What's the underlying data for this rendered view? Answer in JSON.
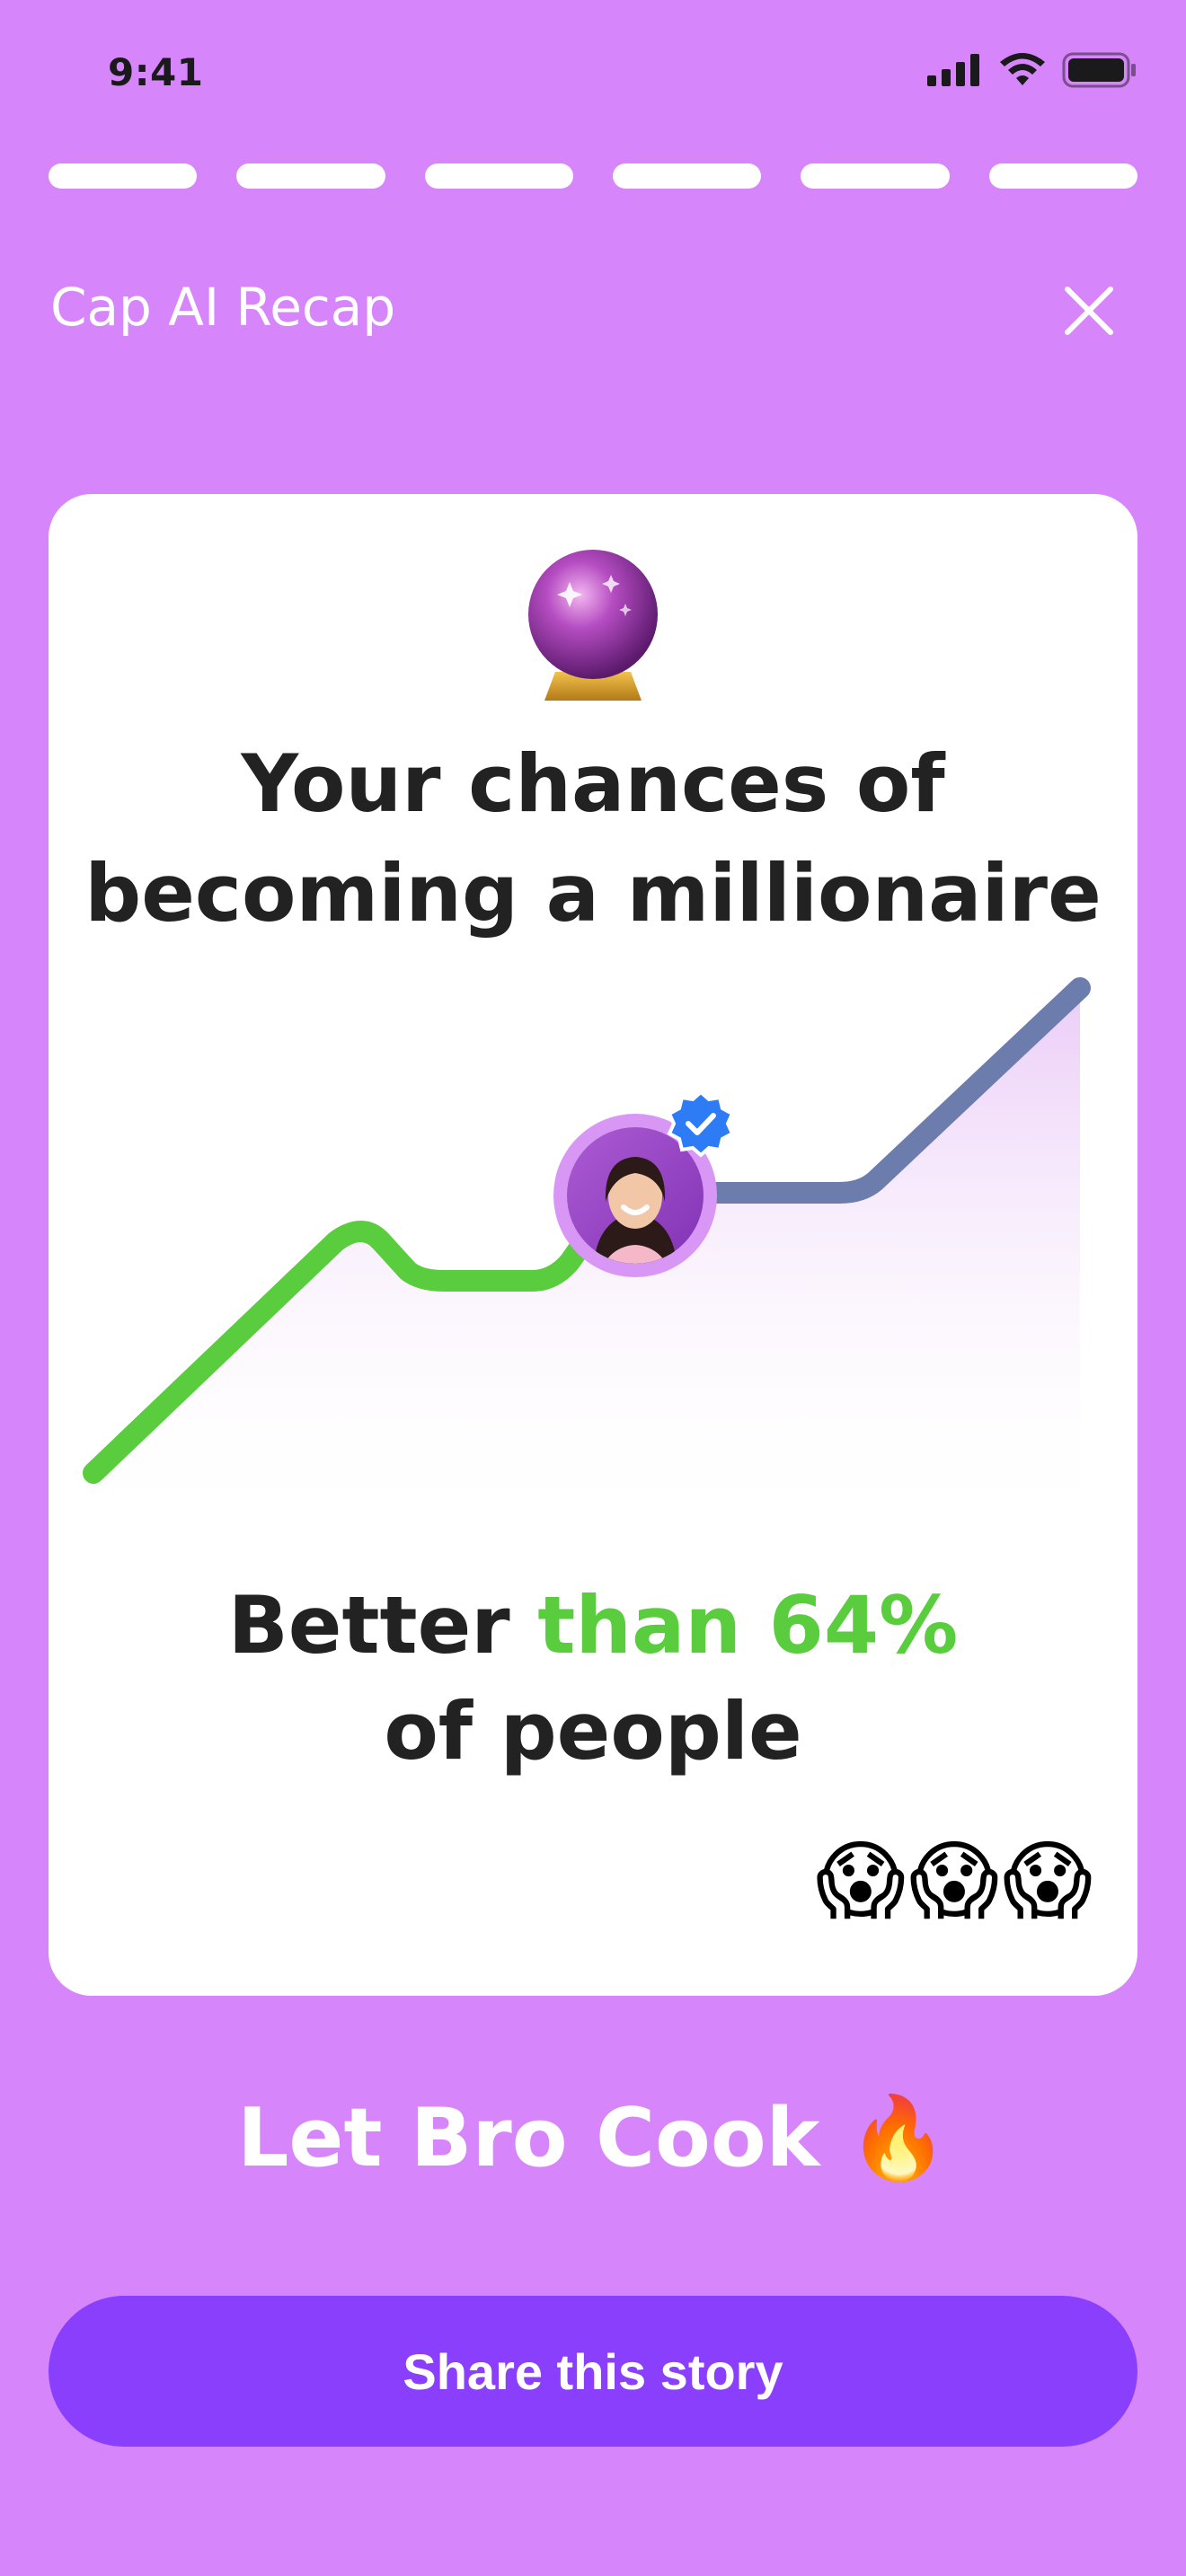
{
  "status_bar": {
    "time": "9:41"
  },
  "story": {
    "segment_count": 6,
    "segments_completed": 6
  },
  "header": {
    "title": "Cap AI Recap"
  },
  "card": {
    "emoji_top": "crystal-ball",
    "title_line1": "Your chances of",
    "title_line2": "becoming a millionaire",
    "result_prefix": "Better ",
    "result_highlight": "than 64%",
    "result_line2": "of people",
    "reaction_emojis": [
      "😱",
      "😱",
      "😱"
    ]
  },
  "tagline": {
    "text": "Let Bro Cook",
    "emoji": "🔥"
  },
  "actions": {
    "share_label": "Share this story"
  },
  "colors": {
    "background": "#D685FA",
    "accent_green": "#5ACD3E",
    "line_future": "#6C7DAD",
    "button": "#8A3FFC",
    "verified": "#2E7BF6"
  }
}
